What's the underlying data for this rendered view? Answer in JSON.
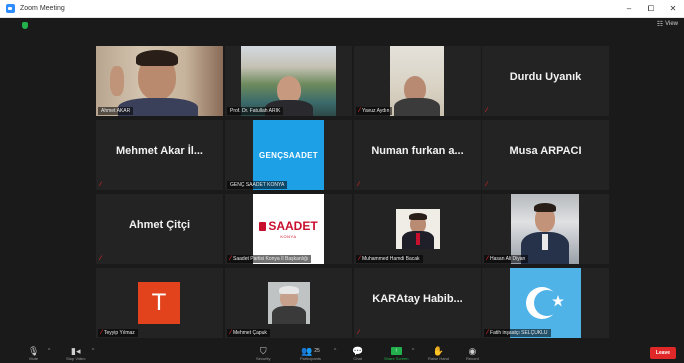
{
  "window": {
    "title": "Zoom Meeting",
    "minimize": "–",
    "maximize": "⧠",
    "close": "✕"
  },
  "topbar": {
    "view_label": "View",
    "view_icon": "grid-view-icon"
  },
  "tiles": [
    {
      "label": "Ahmet AKAR"
    },
    {
      "label": "Prof. Dr. Fatullah ARIK"
    },
    {
      "label": "Yavuz Aydın"
    },
    {
      "big": "Durdu Uyanık"
    },
    {
      "big": "Mehmet Akar İl...",
      "label": ""
    },
    {
      "label": "GENÇ SAADET KONYA",
      "logo": "GENÇSAADET"
    },
    {
      "big": "Numan furkan a..."
    },
    {
      "big": "Musa ARPACI"
    },
    {
      "big": "Ahmet Çitçi"
    },
    {
      "label": "Saadet Partisi Konya İl Başkanlığı",
      "logo": "SAADET",
      "logo_sub": "KONYA"
    },
    {
      "label": "Muhammed Hamdi Bacak"
    },
    {
      "label": "Hasan Ali Diyan"
    },
    {
      "label": "Teyyip Yılmaz",
      "logo": "T"
    },
    {
      "label": "Mehmet Çapuk"
    },
    {
      "big": "KARAtay  Habib..."
    },
    {
      "label": "Fatih inşaatçı  SELÇUKLU"
    }
  ],
  "toolbar": {
    "mute": "Mute",
    "stop_video": "Stop Video",
    "security": "Security",
    "participants": "Participants",
    "participants_count": "25",
    "chat": "Chat",
    "share_screen": "Share Screen",
    "raise_hand": "Raise Hand",
    "record": "Record",
    "leave": "Leave"
  },
  "colors": {
    "active_speaker": "#d9e53c",
    "leave": "#e02828",
    "muted": "#e02828",
    "share": "#22b14c"
  }
}
